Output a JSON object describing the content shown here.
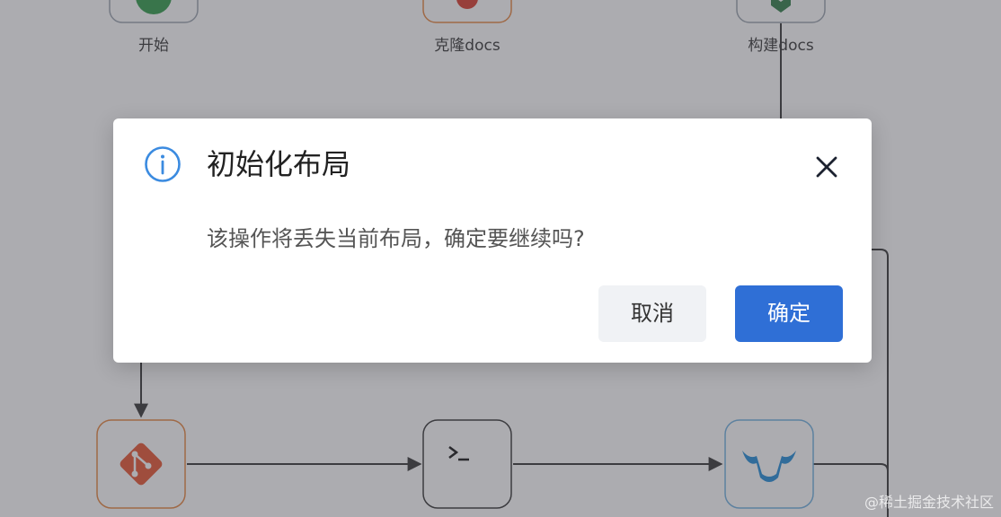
{
  "flow": {
    "nodes": [
      {
        "label": "开始",
        "icon": "start-icon"
      },
      {
        "label": "克隆docs",
        "icon": "clone-icon"
      },
      {
        "label": "构建docs",
        "icon": "build-icon"
      },
      {
        "label": "",
        "icon": "git-icon"
      },
      {
        "label": "",
        "icon": "terminal-icon"
      },
      {
        "label": "",
        "icon": "bull-icon"
      }
    ]
  },
  "dialog": {
    "title": "初始化布局",
    "message": "该操作将丢失当前布局，确定要继续吗?",
    "cancel_label": "取消",
    "confirm_label": "确定",
    "accent_color": "#2f6fd6",
    "icon": "info-icon"
  },
  "watermark": "@稀土掘金技术社区"
}
